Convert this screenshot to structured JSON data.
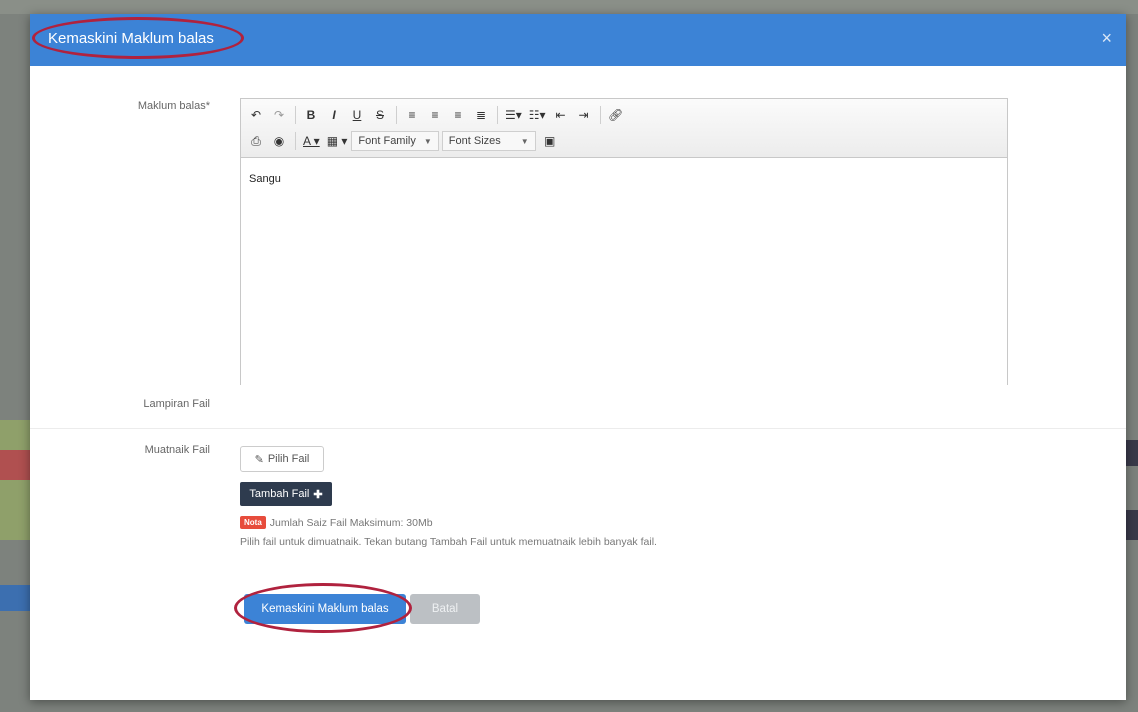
{
  "modal": {
    "title": "Kemaskini Maklum balas",
    "close_glyph": "×"
  },
  "form": {
    "maklum_balas_label": "Maklum balas*",
    "lampiran_label": "Lampiran Fail",
    "muatnaik_label": "Muatnaik Fail"
  },
  "editor": {
    "content": "Sangu",
    "font_family": "Font Family",
    "font_sizes": "Font Sizes"
  },
  "upload": {
    "pilih_fail": "Pilih Fail",
    "tambah_fail": "Tambah Fail",
    "badge": "Nota",
    "note_line1": "Jumlah Saiz Fail Maksimum: 30Mb",
    "note_line2": "Pilih fail untuk dimuatnaik. Tekan butang Tambah Fail untuk memuatnaik lebih banyak fail."
  },
  "actions": {
    "submit": "Kemaskini Maklum balas",
    "cancel": "Batal"
  },
  "icons": {
    "undo": "undo-icon",
    "redo": "redo-icon",
    "print": "print-icon",
    "preview": "preview-icon",
    "link": "link-icon",
    "image": "image-icon",
    "paperclip": "paperclip-icon",
    "plus": "plus-icon"
  },
  "colors": {
    "header": "#3c83d6",
    "annotation_ring": "#b0223e",
    "add_button": "#2e3b4e",
    "badge": "#e74c3c"
  }
}
